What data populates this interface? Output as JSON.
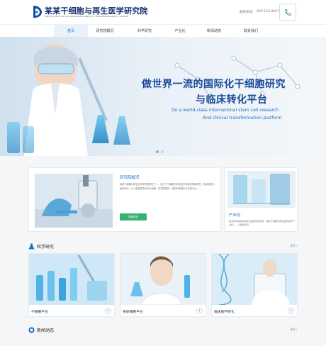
{
  "header": {
    "brand_title": "某某干细胞与再生医学研究院",
    "brand_subtitle": "Moumou Stem Cell and Regenerative Medicine Translational Research Institute",
    "hotline_label": "联系热线：",
    "hotline_number": "400-123-4567"
  },
  "nav": {
    "items": [
      "首页",
      "研究院概况",
      "科学研究",
      "产业化",
      "新闻动态",
      "联系我们"
    ],
    "active_index": 0
  },
  "banner": {
    "headline_1": "做世界一流的国际化干细胞研究",
    "headline_2": "与临床转化平台",
    "english_1": "Do a world-class international stem cell research",
    "english_2": "And clinical transformation platform"
  },
  "about": {
    "title": "研究院概况",
    "description": "某某干细胞与再生医学研究院成立于……致力于干细胞与再生医学领域的基础研究、技术研发与临床转化，为人类健康事业作出贡献。研究院拥有一流的科研团队与实验平台……",
    "button_label": "查看更多"
  },
  "industry": {
    "title": "产业化",
    "description": "整合研究院科研资源与临床转化优势，推动干细胞与再生医学技术产业化…… [查看更多]"
  },
  "science": {
    "title": "科学研究",
    "more_label": "更多+",
    "cards": [
      {
        "label": "干细胞平台"
      },
      {
        "label": "免疫细胞平台"
      },
      {
        "label": "临床医学转化"
      }
    ]
  },
  "news": {
    "title": "新闻动态",
    "more_label": "更多+"
  },
  "colors": {
    "accent_blue": "#1a6fc8",
    "brand_navy": "#1a2f6e",
    "button_green": "#38b06f"
  }
}
